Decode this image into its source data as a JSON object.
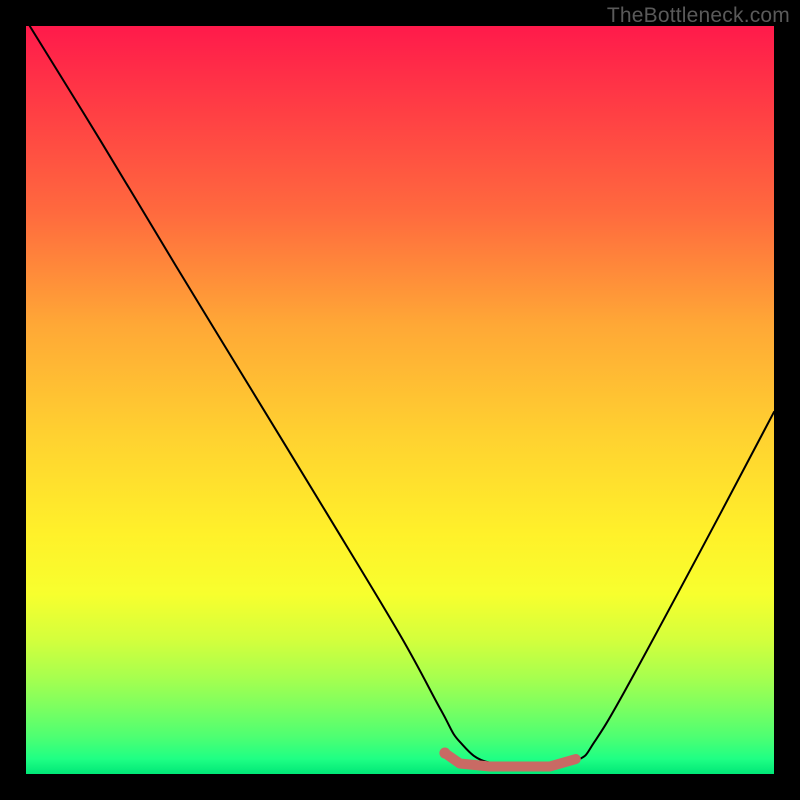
{
  "watermark": "TheBottleneck.com",
  "chart_data": {
    "type": "line",
    "title": "",
    "xlabel": "",
    "ylabel": "",
    "xlim": [
      0,
      1
    ],
    "ylim": [
      0,
      1
    ],
    "background_gradient": {
      "direction": "vertical",
      "stops": [
        {
          "pos": 0.0,
          "color": "#ff1a4b"
        },
        {
          "pos": 0.4,
          "color": "#ffa836"
        },
        {
          "pos": 0.68,
          "color": "#fff12a"
        },
        {
          "pos": 1.0,
          "color": "#00e777"
        }
      ]
    },
    "series": [
      {
        "name": "curve",
        "color": "#000000",
        "width": 2,
        "x": [
          0.005,
          0.1,
          0.2,
          0.3,
          0.4,
          0.5,
          0.555,
          0.58,
          0.62,
          0.7,
          0.74,
          0.76,
          0.8,
          0.9,
          1.0
        ],
        "y": [
          1.0,
          0.846,
          0.68,
          0.516,
          0.352,
          0.186,
          0.085,
          0.043,
          0.015,
          0.015,
          0.02,
          0.043,
          0.11,
          0.295,
          0.484
        ]
      },
      {
        "name": "bottom-marker",
        "color": "#c96a64",
        "width": 10,
        "type": "marker-line",
        "x": [
          0.56,
          0.58,
          0.62,
          0.66,
          0.7,
          0.735
        ],
        "y": [
          0.028,
          0.014,
          0.01,
          0.01,
          0.01,
          0.02
        ]
      }
    ],
    "annotations": []
  }
}
